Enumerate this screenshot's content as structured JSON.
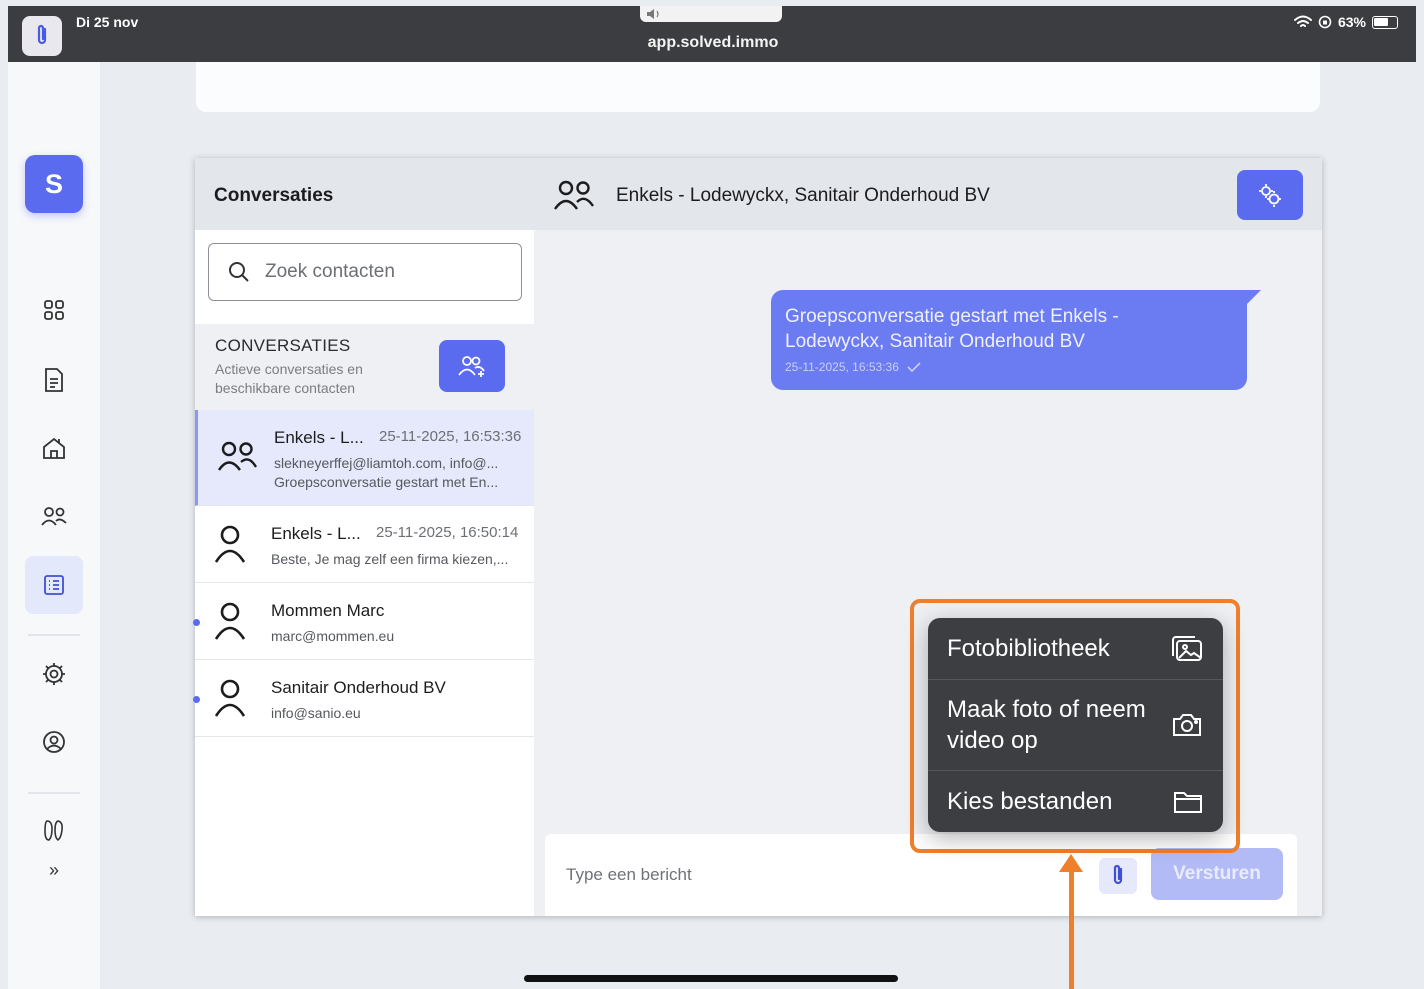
{
  "status_bar": {
    "date": "Di 25 nov",
    "url": "app.solved.immo",
    "battery": "63%"
  },
  "brand": {
    "logo_letter": "S",
    "accent": "#5a6bf0"
  },
  "rail": {
    "more": "»"
  },
  "header": {
    "section_title": "Conversaties",
    "chat_title": "Enkels - Lodewyckx, Sanitair Onderhoud BV"
  },
  "search": {
    "placeholder": "Zoek contacten"
  },
  "conversations": {
    "heading": "CONVERSATIES",
    "subtitle": "Actieve conversaties en beschikbare contacten",
    "items": [
      {
        "name": "Enkels - L...",
        "time": "25-11-2025, 16:53:36",
        "line1": "slekneyerffej@liamtoh.com, info@...",
        "line2": "Groepsconversatie gestart met En...",
        "type": "group"
      },
      {
        "name": "Enkels - L...",
        "time": "25-11-2025, 16:50:14",
        "line1": "Beste, Je mag zelf een firma kiezen,...",
        "type": "person"
      },
      {
        "name": "Mommen Marc",
        "line1": "marc@mommen.eu",
        "type": "person"
      },
      {
        "name": "Sanitair Onderhoud BV",
        "line1": "info@sanio.eu",
        "type": "person"
      }
    ]
  },
  "message": {
    "text": "Groepsconversatie gestart met Enkels - Lodewyckx, Sanitair Onderhoud BV",
    "timestamp": "25-11-2025, 16:53:36",
    "status_icon": "check-icon"
  },
  "composer": {
    "placeholder": "Type een bericht",
    "send_label": "Versturen"
  },
  "attach_menu": {
    "items": [
      {
        "label": "Fotobibliotheek",
        "icon": "photo-library-icon"
      },
      {
        "label": "Maak foto of neem video op",
        "icon": "camera-icon"
      },
      {
        "label": "Kies bestanden",
        "icon": "folder-icon"
      }
    ],
    "highlight_color": "#f07f2b"
  }
}
